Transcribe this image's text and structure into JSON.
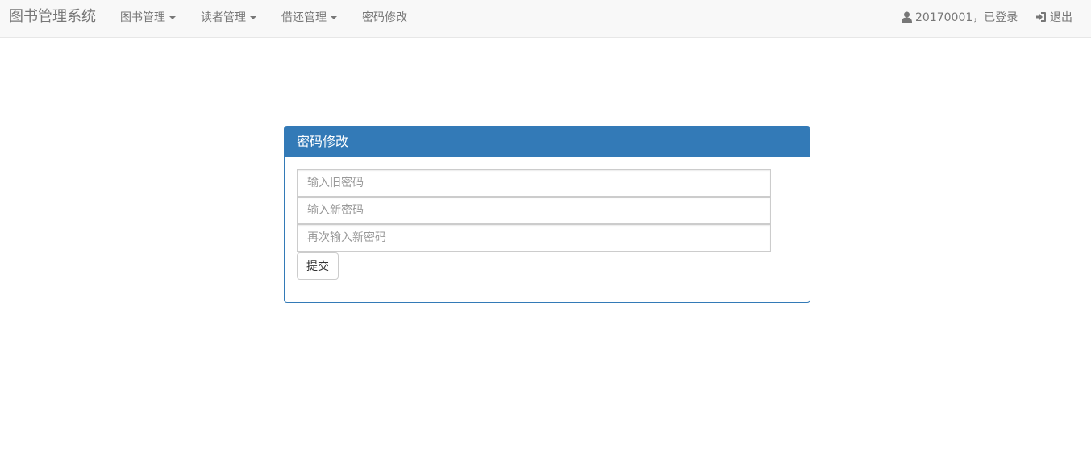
{
  "navbar": {
    "brand": "图书管理系统",
    "menus": [
      {
        "label": "图书管理",
        "dropdown": true
      },
      {
        "label": "读者管理",
        "dropdown": true
      },
      {
        "label": "借还管理",
        "dropdown": true
      },
      {
        "label": "密码修改",
        "dropdown": false
      }
    ],
    "user_status": "20170001，已登录",
    "logout": "退出",
    "icons": {
      "user": "user-icon",
      "logout": "log-in-icon"
    }
  },
  "panel": {
    "title": "密码修改",
    "old_password_placeholder": "输入旧密码",
    "new_password_placeholder": "输入新密码",
    "confirm_password_placeholder": "再次输入新密码",
    "submit_label": "提交"
  },
  "colors": {
    "primary": "#337ab7",
    "navbar_bg": "#f8f8f8",
    "nav_text": "#777777"
  }
}
